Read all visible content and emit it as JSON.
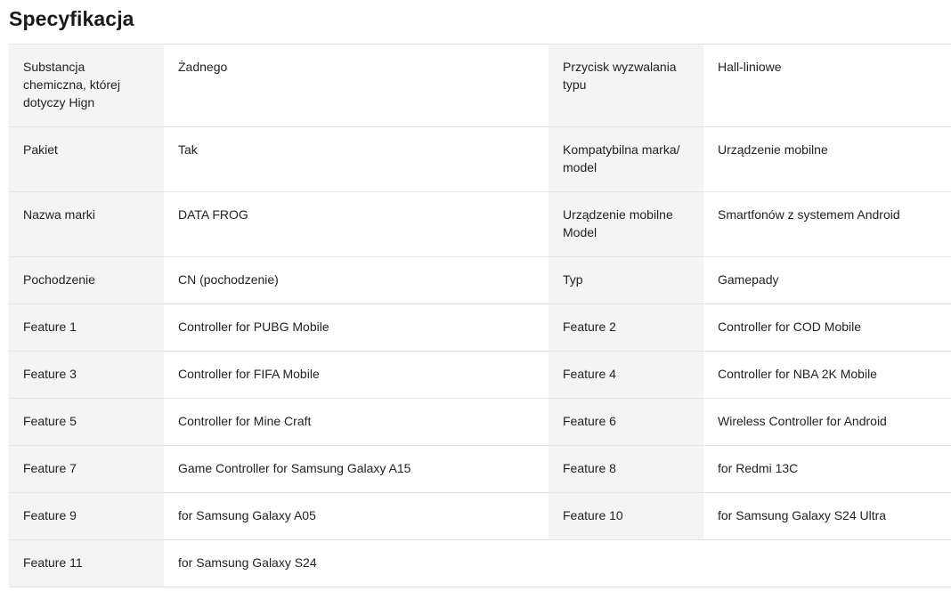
{
  "title": "Specyfikacja",
  "rows": [
    [
      {
        "key": "Substancja chemiczna, której dotyczy Hign",
        "value": "Żadnego"
      },
      {
        "key": "Przycisk wyzwalania typu",
        "value": "Hall-liniowe"
      }
    ],
    [
      {
        "key": "Pakiet",
        "value": "Tak"
      },
      {
        "key": "Kompatybilna marka/ model",
        "value": "Urządzenie mobilne"
      }
    ],
    [
      {
        "key": "Nazwa marki",
        "value": "DATA FROG"
      },
      {
        "key": "Urządzenie mobilne Model",
        "value": "Smartfonów z systemem Android"
      }
    ],
    [
      {
        "key": "Pochodzenie",
        "value": "CN (pochodzenie)"
      },
      {
        "key": "Typ",
        "value": "Gamepady"
      }
    ],
    [
      {
        "key": "Feature 1",
        "value": "Controller for PUBG Mobile"
      },
      {
        "key": "Feature 2",
        "value": "Controller for COD Mobile"
      }
    ],
    [
      {
        "key": "Feature 3",
        "value": "Controller for FIFA Mobile"
      },
      {
        "key": "Feature 4",
        "value": "Controller for NBA 2K Mobile"
      }
    ],
    [
      {
        "key": "Feature 5",
        "value": "Controller for Mine Craft"
      },
      {
        "key": "Feature 6",
        "value": "Wireless Controller for Android"
      }
    ],
    [
      {
        "key": "Feature 7",
        "value": "Game Controller for Samsung Galaxy A15"
      },
      {
        "key": "Feature 8",
        "value": "for Redmi 13C"
      }
    ],
    [
      {
        "key": "Feature 9",
        "value": "for Samsung Galaxy A05"
      },
      {
        "key": "Feature 10",
        "value": "for Samsung Galaxy S24 Ultra"
      }
    ],
    [
      {
        "key": "Feature 11",
        "value": "for Samsung Galaxy S24"
      }
    ]
  ]
}
